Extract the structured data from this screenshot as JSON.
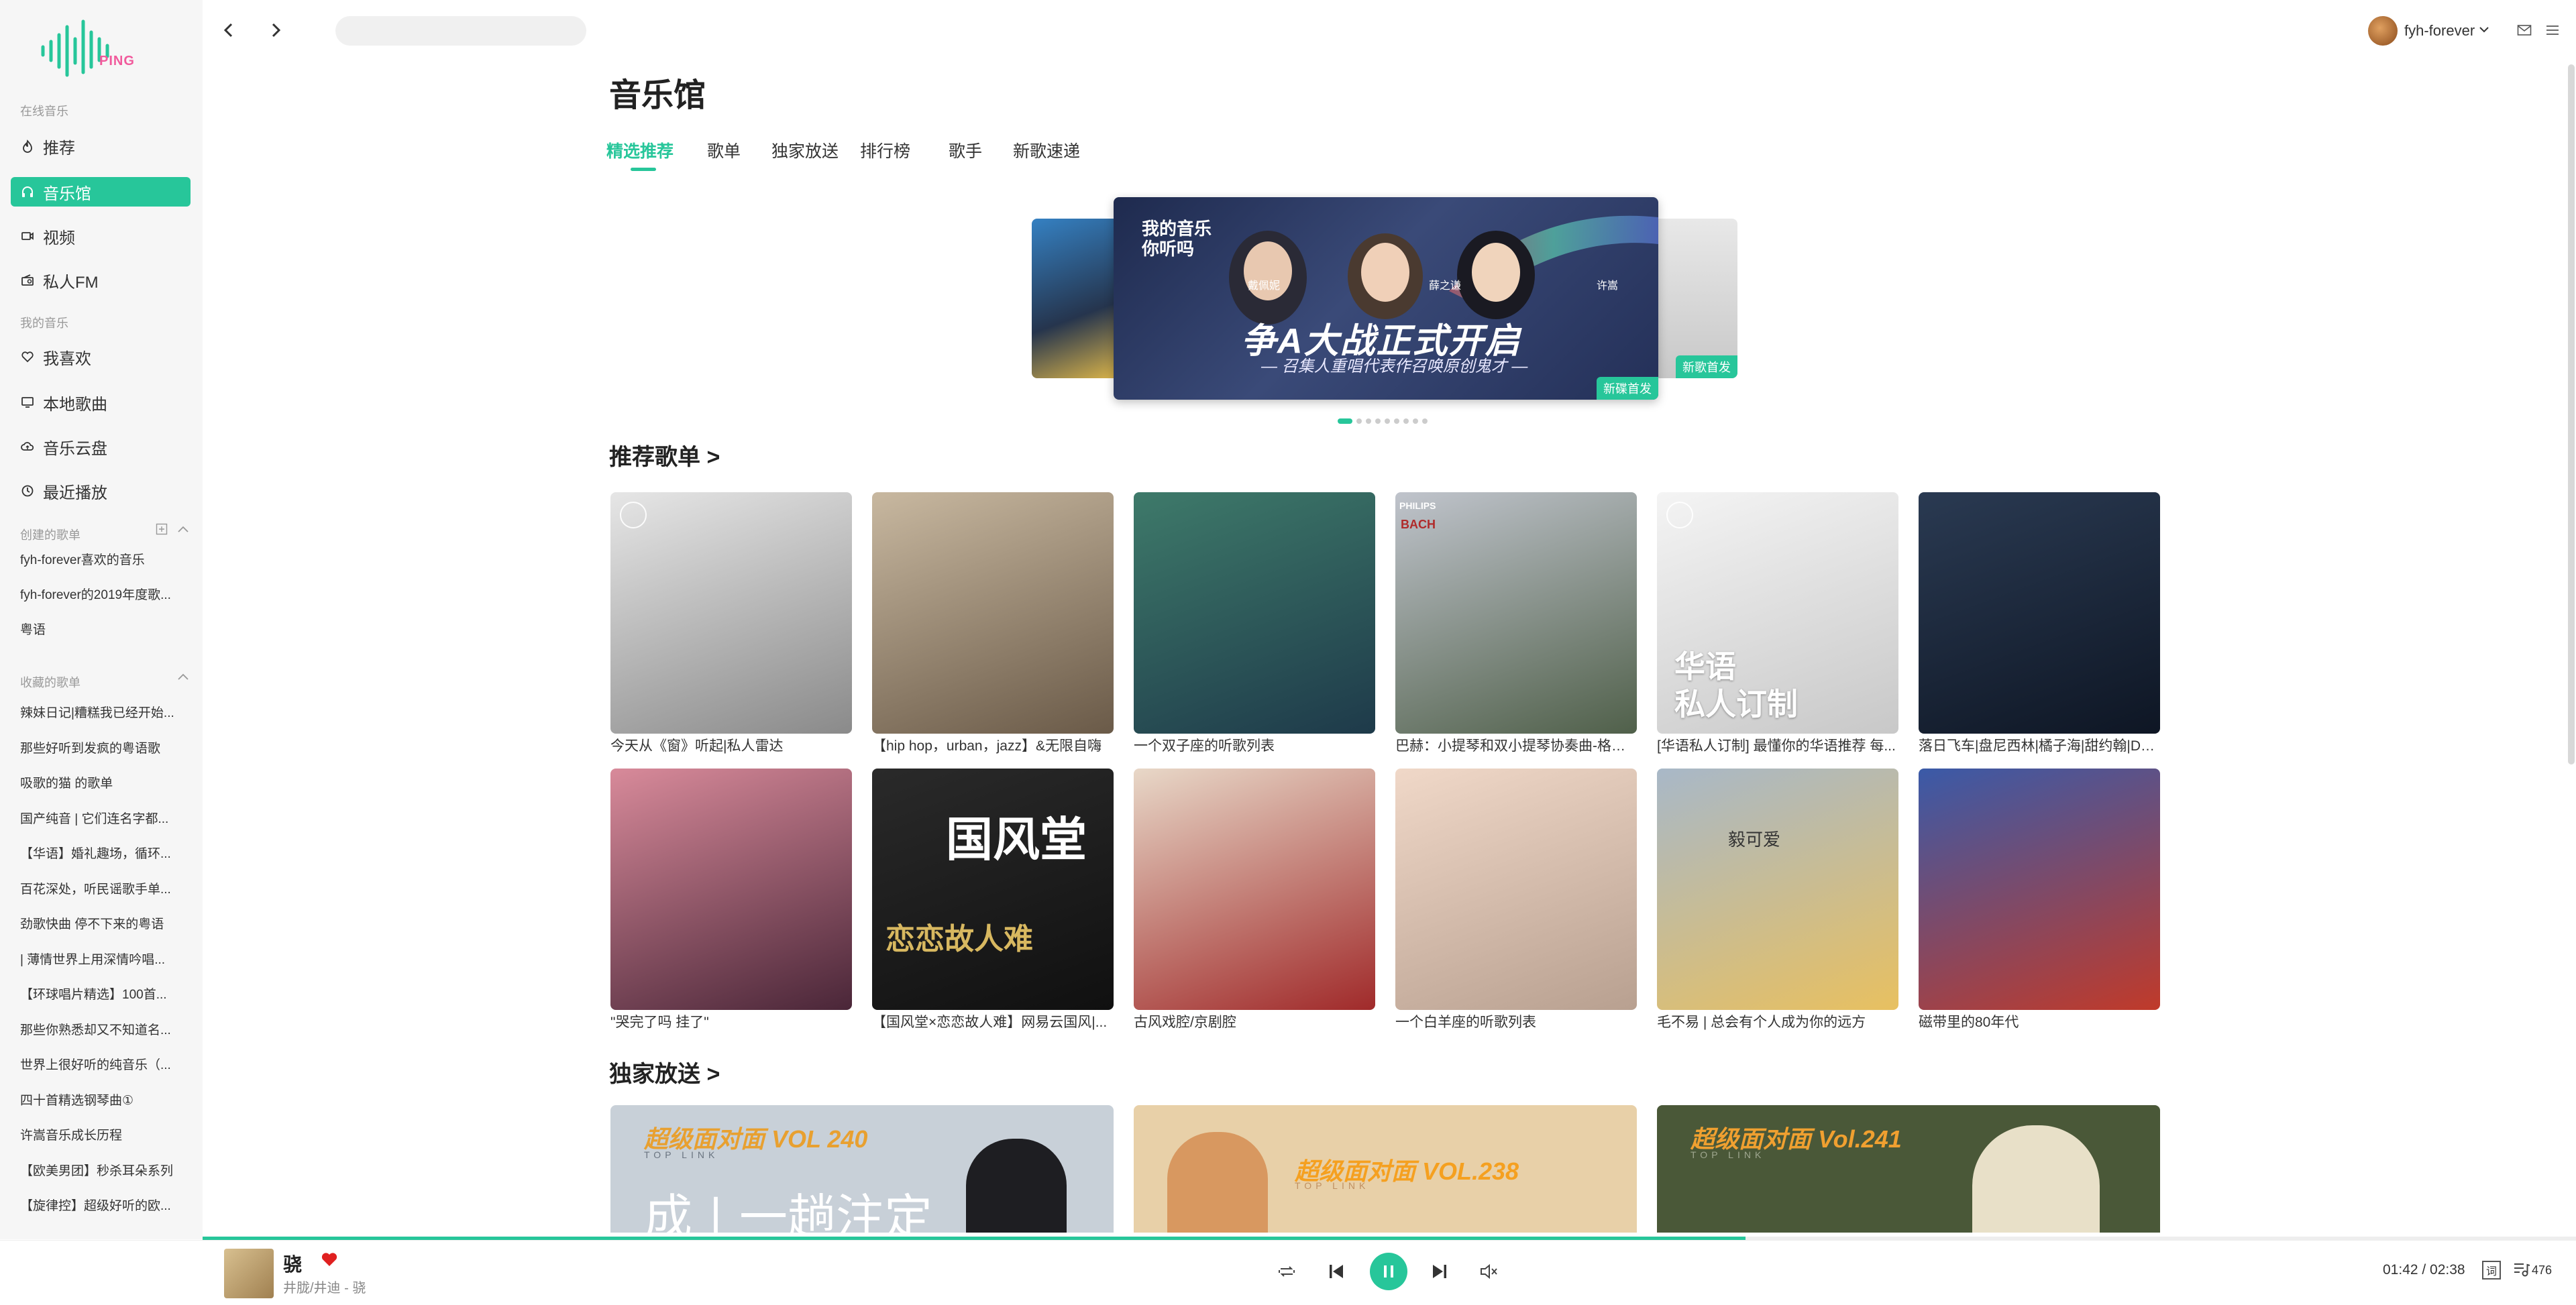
{
  "app": {
    "logo_text": "PING"
  },
  "sidebar": {
    "online_title": "在线音乐",
    "online_items": [
      {
        "label": "推荐",
        "icon": "flame-icon"
      },
      {
        "label": "音乐馆",
        "icon": "headphones-icon",
        "active": true
      },
      {
        "label": "视频",
        "icon": "video-icon"
      },
      {
        "label": "私人FM",
        "icon": "radio-icon"
      }
    ],
    "my_title": "我的音乐",
    "my_items": [
      {
        "label": "我喜欢",
        "icon": "heart-icon"
      },
      {
        "label": "本地歌曲",
        "icon": "monitor-icon"
      },
      {
        "label": "音乐云盘",
        "icon": "cloud-icon"
      },
      {
        "label": "最近播放",
        "icon": "clock-icon"
      }
    ],
    "created_title": "创建的歌单",
    "created_items": [
      "fyh-forever喜欢的音乐",
      "fyh-forever的2019年度歌...",
      "粤语"
    ],
    "collected_title": "收藏的歌单",
    "collected_items": [
      "辣妹日记|糟糕我已经开始...",
      "那些好听到发疯的粤语歌",
      "吸歌的猫 的歌单",
      "国产纯音 | 它们连名字都...",
      "【华语】婚礼趣场，循环...",
      "百花深处，听民谣歌手单...",
      "劲歌快曲 停不下来的粤语",
      "| 薄情世界上用深情吟唱...",
      "【环球唱片精选】100首...",
      "那些你熟悉却又不知道名...",
      "世界上很好听的纯音乐（...",
      "四十首精选钢琴曲①",
      "许嵩音乐成长历程",
      "【欧美男团】秒杀耳朵系列",
      "【旋律控】超级好听的欧..."
    ]
  },
  "header": {
    "search_placeholder": "",
    "username": "fyh-forever"
  },
  "main": {
    "title": "音乐馆",
    "tabs": [
      "精选推荐",
      "歌单",
      "独家放送",
      "排行榜",
      "歌手",
      "新歌速递"
    ],
    "banner": {
      "headline": "争A大战正式开启",
      "subline": "— 召集人重唱代表作召唤原创鬼才 —",
      "tag": "新碟首发",
      "right_tag": "新歌首发",
      "corner_text": "我的音乐你听吗",
      "names": [
        "戴佩妮",
        "薛之谦",
        "许嵩"
      ]
    },
    "recommend_title": "推荐歌单 >",
    "playlists": [
      {
        "label": "今天从《窗》听起|私人雷达",
        "colors": [
          "#e6e6e6",
          "#8a8a8a"
        ]
      },
      {
        "label": "【hip hop，urban，jazz】&无限自嗨",
        "colors": [
          "#c8b8a0",
          "#6a5a48"
        ]
      },
      {
        "label": "一个双子座的听歌列表",
        "colors": [
          "#3e7a6a",
          "#1e3a4a"
        ]
      },
      {
        "label": "巴赫：小提琴和双小提琴协奏曲-格鲁...",
        "colors": [
          "#c0c4cc",
          "#50604a"
        ]
      },
      {
        "label": "[华语私人订制] 最懂你的华语推荐 每...",
        "colors": [
          "#f4f4f4",
          "#c8c8c8"
        ]
      },
      {
        "label": "落日飞车|盘尼西林|橘子海|甜约翰|De...",
        "colors": [
          "#2a3a52",
          "#0e1624"
        ]
      },
      {
        "label": "\"哭完了吗 挂了\"",
        "colors": [
          "#d88a9a",
          "#4a2638"
        ]
      },
      {
        "label": "【国风堂×恋恋故人难】网易云国风|...",
        "colors": [
          "#2a2a2a",
          "#101010"
        ]
      },
      {
        "label": "古风戏腔/京剧腔",
        "colors": [
          "#e8d8c8",
          "#a02a2a"
        ]
      },
      {
        "label": "一个白羊座的听歌列表",
        "colors": [
          "#f0d8c8",
          "#b8a090"
        ]
      },
      {
        "label": "毛不易 | 总会有个人成为你的远方",
        "colors": [
          "#a8b8c8",
          "#e8c060"
        ]
      },
      {
        "label": "磁带里的80年代",
        "colors": [
          "#3a5aa8",
          "#c03a2a"
        ]
      }
    ],
    "overlay_text": "华语\n私人订制",
    "seal_text_1": "国风堂",
    "seal_text_2": "恋恋故人难",
    "mao_text": "毅可爱",
    "philips_text": "PHILIPS",
    "bach_text": "BACH",
    "exclusive_title": "独家放送 >",
    "exclusives": [
      {
        "title": "超级面对面 VOL 240",
        "sub": "TOP LINK",
        "line": "成 | 一趟注定",
        "bg": "#c8d0d8"
      },
      {
        "title": "超级面对面 VOL.238",
        "sub": "TOP LINK",
        "line": "",
        "bg": "#e8d0a8"
      },
      {
        "title": "超级面对面 Vol.241",
        "sub": "TOP LINK",
        "line": "",
        "bg": "#4a5838"
      }
    ]
  },
  "player": {
    "song": "骁",
    "artist": "井胧/井迪 - 骁",
    "time": "01:42 / 02:38",
    "progress": 0.65,
    "lyric_label": "词",
    "count": "476",
    "accent": "#27c69a"
  }
}
